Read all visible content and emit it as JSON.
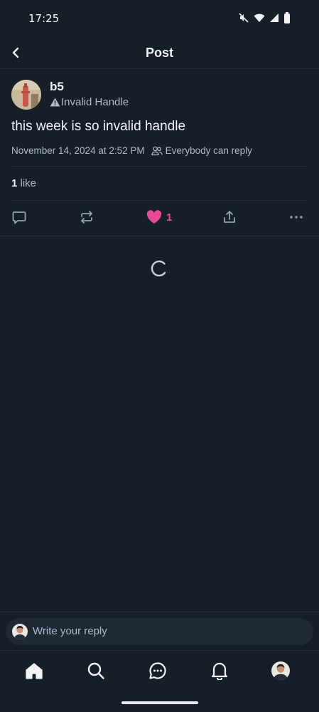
{
  "status_bar": {
    "time": "17:25",
    "icons": [
      "mute-icon",
      "wifi-icon",
      "signal-icon",
      "battery-icon"
    ]
  },
  "header": {
    "title": "Post",
    "back_icon": "chevron-left-icon"
  },
  "post": {
    "author_name": "b5",
    "author_handle": "Invalid Handle",
    "text": "this week is so invalid handle",
    "timestamp": "November 14, 2024 at 2:52 PM",
    "reply_setting": "Everybody can reply",
    "likes_count": "1",
    "likes_label": "like",
    "actions": {
      "reply_icon": "reply-icon",
      "repost_icon": "repost-icon",
      "like_icon": "heart-icon",
      "like_count": "1",
      "share_icon": "share-icon",
      "more_icon": "more-icon"
    }
  },
  "composer": {
    "placeholder": "Write your reply"
  },
  "bottom_nav": {
    "items": [
      "home-icon",
      "search-icon",
      "chat-icon",
      "bell-icon",
      "profile-avatar"
    ]
  },
  "colors": {
    "background": "#161e27",
    "text": "#f1f3f5",
    "muted": "#aebbc9",
    "border": "#232d38",
    "like_accent": "#ec4899",
    "composer_bg": "#1e2935"
  }
}
